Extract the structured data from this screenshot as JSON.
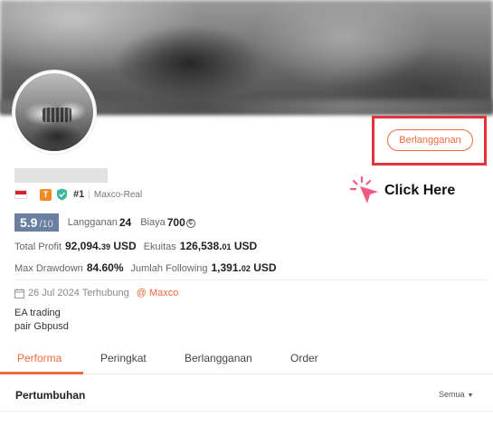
{
  "profile": {
    "subscribe_label": "Berlangganan",
    "rank": "#1",
    "broker_badge": "Maxco-Real",
    "score": "5.9",
    "score_max": "/10",
    "subscribers_label": "Langganan",
    "subscribers_value": "24",
    "fee_label": "Biaya",
    "fee_value": "700",
    "fee_icon": "coin-icon",
    "country_flag": "indonesia-flag-icon",
    "badge_t": "T",
    "colors": {
      "accent": "#ee6a3c",
      "highlight": "#e4343a",
      "score_bg": "#6b7fa0",
      "badge_orange": "#f08a24",
      "shield_green": "#3bb7a0"
    }
  },
  "annotation": {
    "click_here": "Click Here",
    "pointer_icon": "cursor-click-icon"
  },
  "stats": {
    "total_profit_label": "Total Profit",
    "total_profit_int": "92,094.",
    "total_profit_dec": "39",
    "total_profit_unit": " USD",
    "equity_label": "Ekuitas",
    "equity_int": "126,538.",
    "equity_dec": "01",
    "equity_unit": " USD",
    "max_drawdown_label": "Max Drawdown",
    "max_drawdown_value": "84.60%",
    "following_label": "Jumlah Following",
    "following_int": "1,391.",
    "following_dec": "02",
    "following_unit": " USD"
  },
  "connection": {
    "date_text": "26 Jul 2024 Terhubung",
    "broker": "@ Maxco"
  },
  "description": {
    "line1": "EA trading",
    "line2": "pair Gbpusd"
  },
  "tabs": [
    {
      "label": "Performa",
      "active": true
    },
    {
      "label": "Peringkat",
      "active": false
    },
    {
      "label": "Berlangganan",
      "active": false
    },
    {
      "label": "Order",
      "active": false
    }
  ],
  "section": {
    "title": "Pertumbuhan",
    "filter_label": "Semua"
  }
}
